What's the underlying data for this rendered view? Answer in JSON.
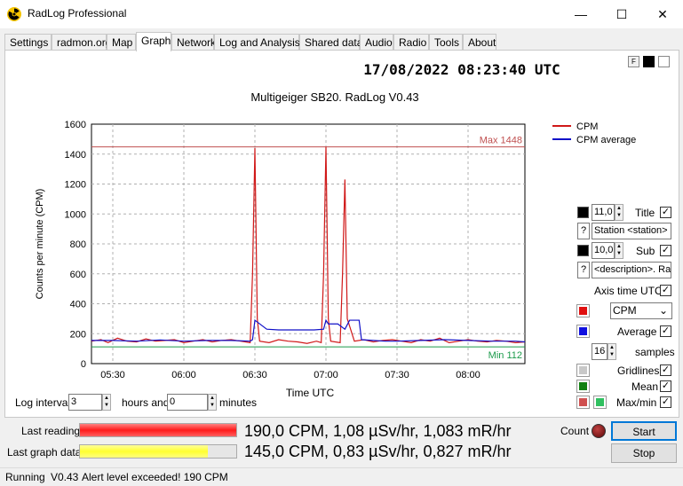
{
  "window": {
    "title": "RadLog Professional",
    "minimize": "—",
    "maximize": "☐",
    "close": "✕"
  },
  "tabs": [
    "Settings",
    "radmon.org",
    "Map",
    "Graph",
    "Network",
    "Log and Analysis",
    "Shared data",
    "Audio",
    "Radio",
    "Tools",
    "About"
  ],
  "active_tab": "Graph",
  "clock": "17/08/2022 08:23:40 UTC",
  "font_button": "F",
  "colors": {
    "cpm": "#d01818",
    "average": "#1010c8",
    "max_line": "#c05050",
    "min_line": "#1a9a4a",
    "grid": "#b0b0b0",
    "count_led": "#7a1010",
    "progress_last": "#ff2a2a",
    "progress_graph": "#ffff50"
  },
  "chart_data": {
    "type": "line",
    "title": "Multigeiger SB20. RadLog V0.43",
    "xlabel": "Time UTC",
    "ylabel": "Counts per minute (CPM)",
    "x_ticks": [
      "05:30",
      "06:00",
      "06:30",
      "07:00",
      "07:30",
      "08:00"
    ],
    "y_ticks": [
      0,
      200,
      400,
      600,
      800,
      1000,
      1200,
      1400,
      1600
    ],
    "ylim": [
      0,
      1600
    ],
    "xlim": [
      "05:21",
      "08:24"
    ],
    "grid": true,
    "legend_position": "top-right",
    "max_line": {
      "label": "Max 1448",
      "value": 1448
    },
    "min_line": {
      "label": "Min 112",
      "value": 112
    },
    "series": [
      {
        "name": "CPM",
        "x": [
          "05:21",
          "05:25",
          "05:28",
          "05:32",
          "05:36",
          "05:40",
          "05:44",
          "05:48",
          "05:52",
          "05:56",
          "06:00",
          "06:04",
          "06:08",
          "06:12",
          "06:16",
          "06:20",
          "06:24",
          "06:28",
          "06:29",
          "06:30",
          "06:31",
          "06:32",
          "06:36",
          "06:40",
          "06:44",
          "06:48",
          "06:52",
          "06:56",
          "06:58",
          "06:59",
          "07:00",
          "07:01",
          "07:02",
          "07:06",
          "07:07",
          "07:08",
          "07:09",
          "07:12",
          "07:16",
          "07:20",
          "07:24",
          "07:28",
          "07:32",
          "07:36",
          "07:40",
          "07:44",
          "07:48",
          "07:52",
          "07:56",
          "08:00",
          "08:04",
          "08:08",
          "08:12",
          "08:16",
          "08:20",
          "08:24"
        ],
        "values": [
          150,
          160,
          140,
          170,
          150,
          145,
          165,
          150,
          155,
          160,
          140,
          150,
          160,
          145,
          155,
          160,
          150,
          140,
          600,
          1440,
          300,
          150,
          140,
          160,
          150,
          145,
          135,
          150,
          140,
          600,
          1448,
          300,
          150,
          140,
          600,
          1230,
          300,
          150,
          160,
          145,
          155,
          160,
          150,
          140,
          160,
          150,
          170,
          140,
          150,
          160,
          150,
          145,
          155,
          150,
          140,
          145
        ]
      },
      {
        "name": "CPM average",
        "x": [
          "05:21",
          "05:30",
          "05:40",
          "05:50",
          "06:00",
          "06:10",
          "06:20",
          "06:28",
          "06:29",
          "06:30",
          "06:35",
          "06:40",
          "06:45",
          "06:50",
          "06:55",
          "06:59",
          "07:00",
          "07:01",
          "07:05",
          "07:08",
          "07:10",
          "07:12",
          "07:14",
          "07:15",
          "07:20",
          "07:25",
          "07:30",
          "07:40",
          "07:50",
          "08:00",
          "08:10",
          "08:20",
          "08:24"
        ],
        "values": [
          155,
          155,
          150,
          158,
          150,
          155,
          155,
          150,
          160,
          290,
          230,
          225,
          225,
          225,
          225,
          230,
          290,
          265,
          265,
          230,
          290,
          290,
          290,
          160,
          155,
          150,
          150,
          155,
          160,
          155,
          150,
          150,
          145
        ]
      }
    ]
  },
  "controls": {
    "title_size": "11,0",
    "title_label": "Title",
    "title_text": "Station <station> i",
    "sub_size": "10,0",
    "sub_label": "Sub",
    "sub_text": "<description>. Rad",
    "question": "?",
    "axis_utc_label": "Axis time UTC",
    "series_select": "CPM",
    "average_label": "Average",
    "samples_value": "16",
    "samples_label": "samples",
    "gridlines_label": "Gridlines",
    "mean_label": "Mean",
    "maxmin_label": "Max/min",
    "check": "✓"
  },
  "log_interval": {
    "label": "Log interval",
    "hours": "3",
    "hours_label": "hours and",
    "minutes": "0",
    "minutes_label": "minutes"
  },
  "readings": {
    "last_label": "Last reading",
    "last_value": "190,0 CPM, 1,08 µSv/hr, 1,083 mR/hr",
    "last_progress": 1.0,
    "graph_label": "Last graph data",
    "graph_value": "145,0 CPM, 0,83 µSv/hr, 0,827 mR/hr",
    "graph_progress": 0.82
  },
  "count_label": "Count",
  "start_label": "Start",
  "stop_label": "Stop",
  "status": {
    "state": "Running",
    "version": "V0.43",
    "message": "Alert level exceeded! 190 CPM"
  }
}
